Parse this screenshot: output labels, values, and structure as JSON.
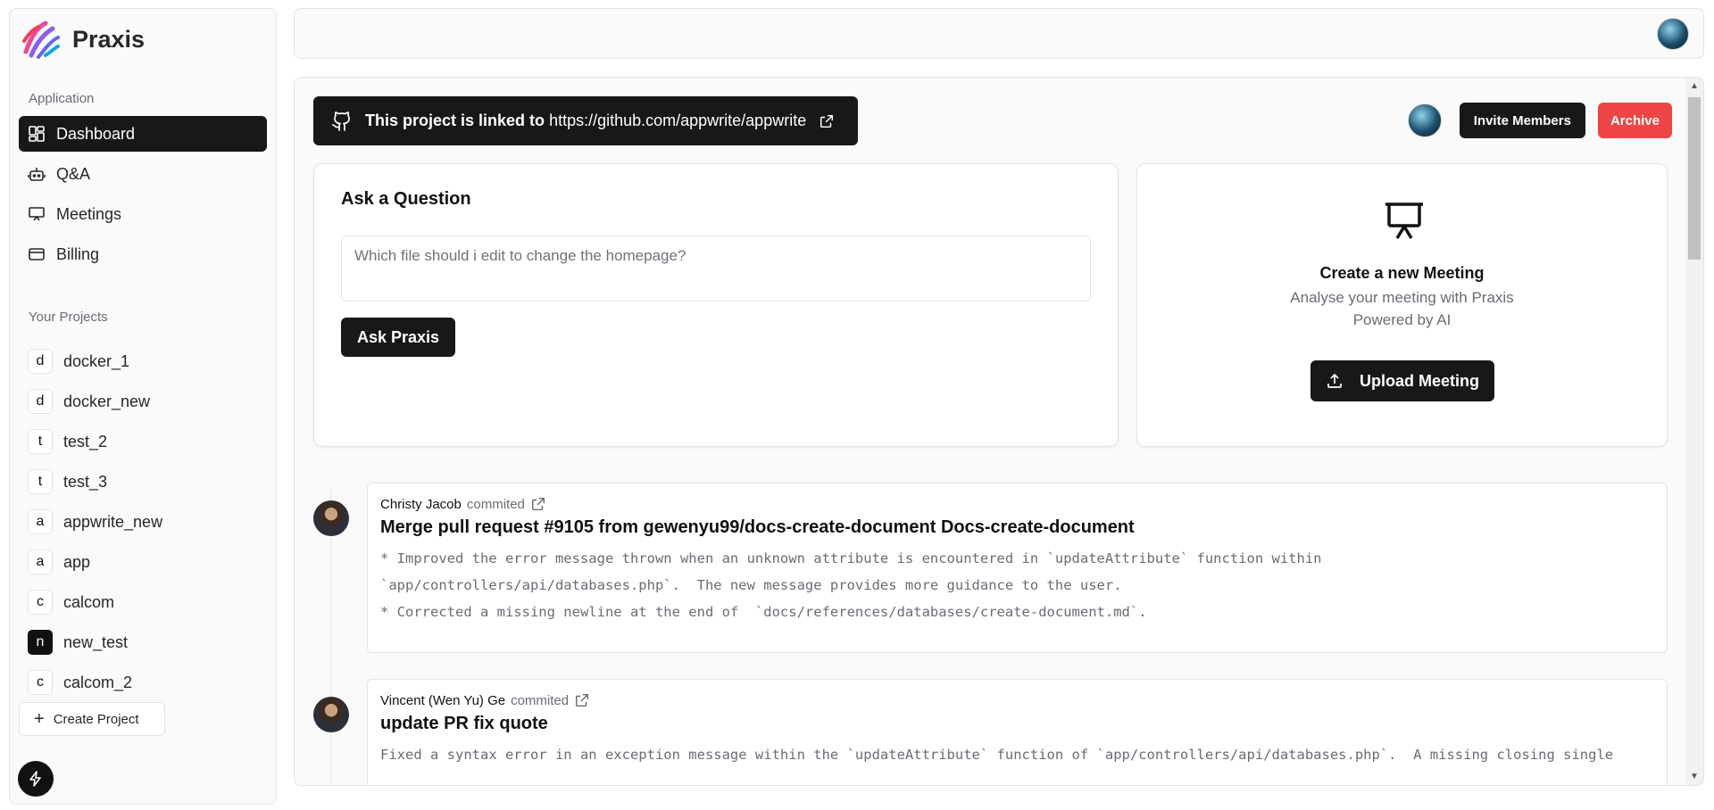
{
  "brand": {
    "name": "Praxis"
  },
  "sidebar": {
    "application_label": "Application",
    "nav": [
      {
        "label": "Dashboard",
        "icon": "dashboard-icon",
        "active": true
      },
      {
        "label": "Q&A",
        "icon": "bot-icon",
        "active": false
      },
      {
        "label": "Meetings",
        "icon": "presentation-icon",
        "active": false
      },
      {
        "label": "Billing",
        "icon": "credit-card-icon",
        "active": false
      }
    ],
    "projects_label": "Your Projects",
    "projects": [
      {
        "initial": "d",
        "name": "docker_1",
        "selected": false
      },
      {
        "initial": "d",
        "name": "docker_new",
        "selected": false
      },
      {
        "initial": "t",
        "name": "test_2",
        "selected": false
      },
      {
        "initial": "t",
        "name": "test_3",
        "selected": false
      },
      {
        "initial": "a",
        "name": "appwrite_new",
        "selected": false
      },
      {
        "initial": "a",
        "name": "app",
        "selected": false
      },
      {
        "initial": "c",
        "name": "calcom",
        "selected": false
      },
      {
        "initial": "n",
        "name": "new_test",
        "selected": true
      },
      {
        "initial": "c",
        "name": "calcom_2",
        "selected": false
      }
    ],
    "create_label": "Create Project"
  },
  "header": {
    "link_prefix": "This project is linked to",
    "link_url": "https://github.com/appwrite/appwrite",
    "invite_label": "Invite Members",
    "archive_label": "Archive"
  },
  "ask": {
    "title": "Ask a Question",
    "placeholder": "Which file should i edit to change the homepage?",
    "button": "Ask Praxis"
  },
  "meeting": {
    "title": "Create a new Meeting",
    "subtitle_line1": "Analyse your meeting with Praxis",
    "subtitle_line2": "Powered by AI",
    "button": "Upload Meeting"
  },
  "commits": [
    {
      "author": "Christy Jacob",
      "verb": "commited",
      "title": "Merge pull request #9105 from gewenyu99/docs-create-document Docs-create-document",
      "body": "* Improved the error message thrown when an unknown attribute is encountered in `updateAttribute` function within\n`app/controllers/api/databases.php`.  The new message provides more guidance to the user.\n* Corrected a missing newline at the end of  `docs/references/databases/create-document.md`."
    },
    {
      "author": "Vincent (Wen Yu) Ge",
      "verb": "commited",
      "title": "update PR fix quote",
      "body": "Fixed a syntax error in an exception message within the `updateAttribute` function of `app/controllers/api/databases.php`.  A missing closing single"
    }
  ],
  "colors": {
    "primary": "#18181b",
    "danger": "#ef4444",
    "surface": "#fafafa",
    "border": "#e4e4e7",
    "muted_text": "#6b6b75"
  }
}
